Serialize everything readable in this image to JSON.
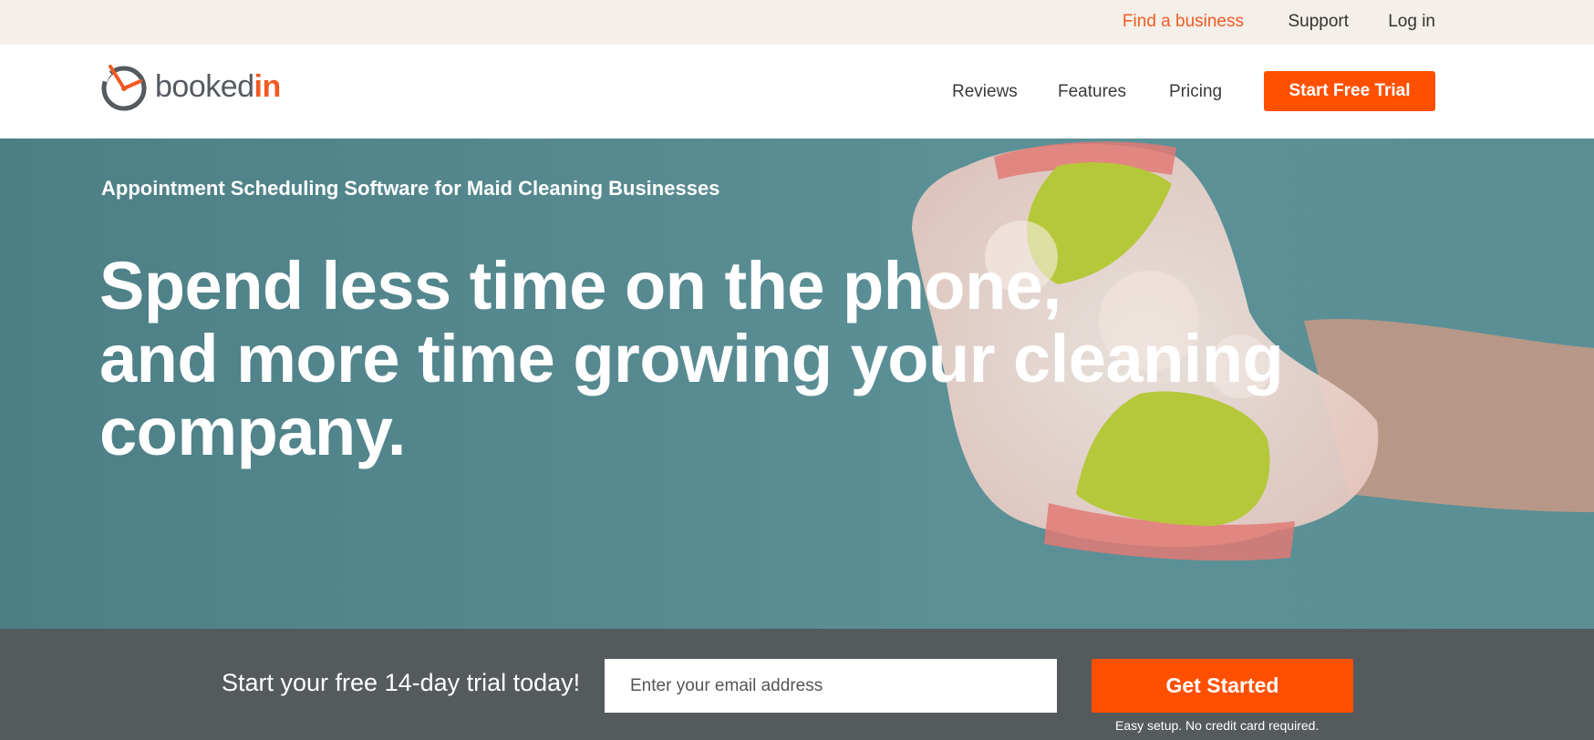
{
  "topbar": {
    "find_business": "Find a business",
    "support": "Support",
    "login": "Log in"
  },
  "logo": {
    "text_primary": "booked",
    "text_accent": "in"
  },
  "nav": {
    "reviews": "Reviews",
    "features": "Features",
    "pricing": "Pricing",
    "trial_button": "Start Free Trial"
  },
  "hero": {
    "eyebrow": "Appointment Scheduling Software for Maid Cleaning Businesses",
    "headline_line1": "Spend less time on the phone,",
    "headline_line2": "and more time growing your cleaning",
    "headline_line3": "company."
  },
  "signup": {
    "prompt": "Start your free 14-day trial today!",
    "email_placeholder": "Enter your email address",
    "button": "Get Started",
    "fine_print": "Easy setup. No credit card required."
  },
  "colors": {
    "brand_orange": "#ff5000",
    "link_orange": "#f15a24",
    "hero_teal": "#578a90",
    "signup_gray": "#555a5d",
    "topbar_beige": "#f4efe8"
  },
  "icons": {
    "logo_mark": "clock-icon",
    "hero_image": "sponge-in-hand-image"
  }
}
